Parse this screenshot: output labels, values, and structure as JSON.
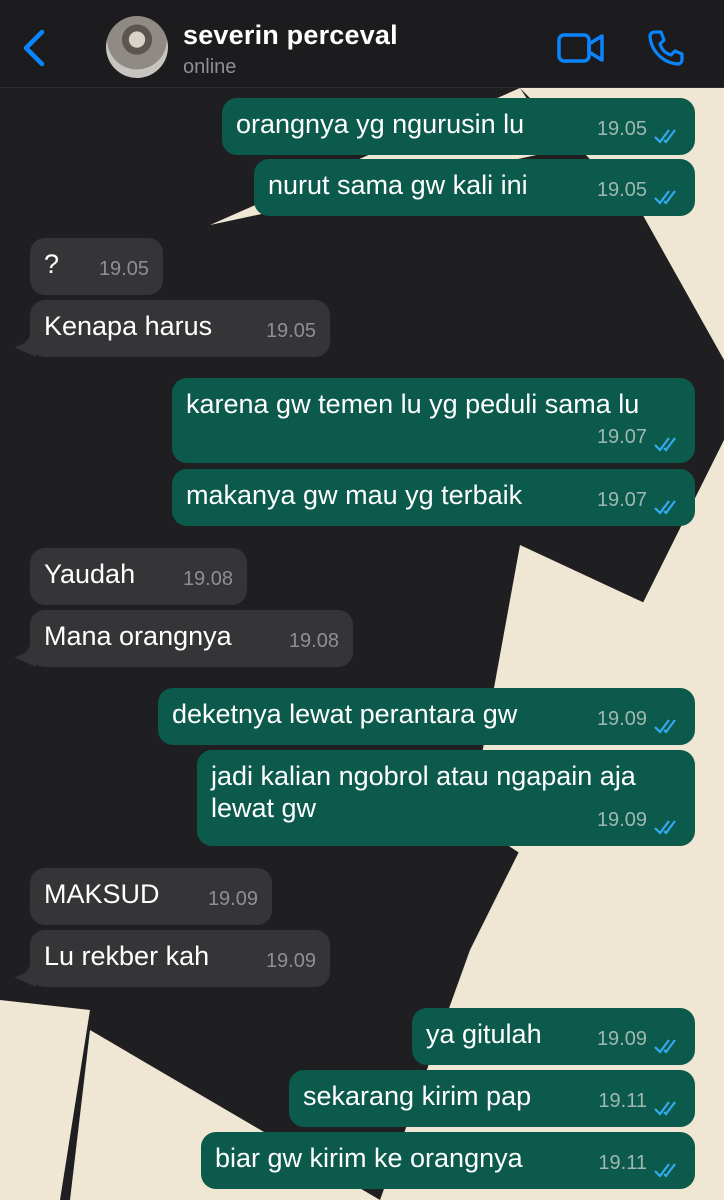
{
  "header": {
    "contact_name": "severin perceval",
    "status": "online"
  },
  "colors": {
    "outgoing_bubble": "#0b5a4b",
    "incoming_bubble": "#353538",
    "accent": "#0a84ff",
    "read_ticks": "#34aaf0",
    "wallpaper_dark": "#1f1f22",
    "wallpaper_light": "#efe6d3"
  },
  "icons": {
    "back": "chevron-left-icon",
    "video": "video-camera-icon",
    "call": "phone-icon",
    "read": "double-check-icon"
  },
  "messages": [
    {
      "dir": "out",
      "text": "orangnya yg ngurusin lu",
      "time": "19.05",
      "read": true
    },
    {
      "dir": "out",
      "text": "nurut sama gw kali ini",
      "time": "19.05",
      "read": true
    },
    {
      "dir": "in",
      "text": "?",
      "time": "19.05"
    },
    {
      "dir": "in",
      "text": "Kenapa harus",
      "time": "19.05"
    },
    {
      "dir": "out",
      "text": "karena gw temen lu yg peduli sama lu",
      "time": "19.07",
      "read": true
    },
    {
      "dir": "out",
      "text": "makanya gw mau yg terbaik",
      "time": "19.07",
      "read": true
    },
    {
      "dir": "in",
      "text": "Yaudah",
      "time": "19.08"
    },
    {
      "dir": "in",
      "text": "Mana orangnya",
      "time": "19.08"
    },
    {
      "dir": "out",
      "text": "deketnya lewat perantara gw",
      "time": "19.09",
      "read": true
    },
    {
      "dir": "out",
      "text": "jadi kalian ngobrol atau ngapain aja\nlewat gw",
      "time": "19.09",
      "read": true
    },
    {
      "dir": "in",
      "text": "MAKSUD",
      "time": "19.09"
    },
    {
      "dir": "in",
      "text": "Lu rekber kah",
      "time": "19.09"
    },
    {
      "dir": "out",
      "text": "ya gitulah",
      "time": "19.09",
      "read": true
    },
    {
      "dir": "out",
      "text": "sekarang kirim pap",
      "time": "19.11",
      "read": true
    },
    {
      "dir": "out",
      "text": "biar gw kirim ke orangnya",
      "time": "19.11",
      "read": true
    }
  ]
}
